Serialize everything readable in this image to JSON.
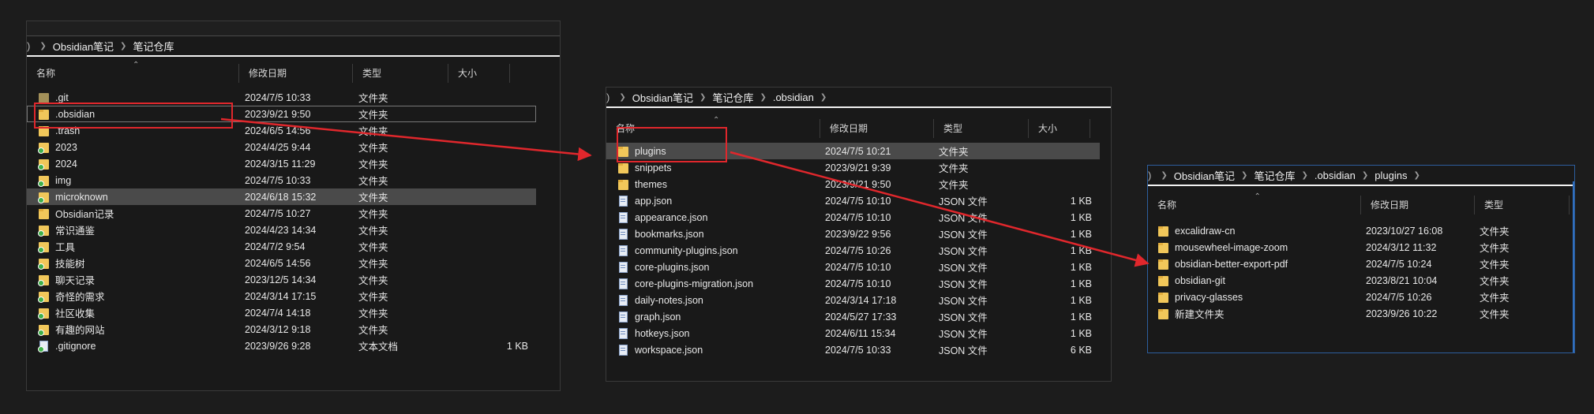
{
  "colors": {
    "background": "#1c1c1c",
    "window": "#191919",
    "selected_row": "#4a4a4a",
    "highlight_box": "#e0272c",
    "folder": "#f1c75a",
    "sync_badge": "#3fb04a"
  },
  "headers": {
    "name": "名称",
    "modified": "修改日期",
    "type": "类型",
    "size": "大小"
  },
  "win1": {
    "breadcrumb": [
      "Obsidian笔记",
      "笔记仓库"
    ],
    "rows": [
      {
        "name": ".git",
        "modified": "2024/7/5 10:33",
        "type": "文件夹",
        "size": "",
        "icon": "folder-dim-icon"
      },
      {
        "name": ".obsidian",
        "modified": "2023/9/21 9:50",
        "type": "文件夹",
        "size": "",
        "icon": "folder-icon"
      },
      {
        "name": ".trash",
        "modified": "2024/6/5 14:56",
        "type": "文件夹",
        "size": "",
        "icon": "folder-icon"
      },
      {
        "name": "2023",
        "modified": "2024/4/25 9:44",
        "type": "文件夹",
        "size": "",
        "icon": "folder-sync-icon"
      },
      {
        "name": "2024",
        "modified": "2024/3/15 11:29",
        "type": "文件夹",
        "size": "",
        "icon": "folder-sync-icon"
      },
      {
        "name": "img",
        "modified": "2024/7/5 10:33",
        "type": "文件夹",
        "size": "",
        "icon": "folder-sync-icon"
      },
      {
        "name": "microknown",
        "modified": "2024/6/18 15:32",
        "type": "文件夹",
        "size": "",
        "icon": "folder-sync-icon"
      },
      {
        "name": "Obsidian记录",
        "modified": "2024/7/5 10:27",
        "type": "文件夹",
        "size": "",
        "icon": "folder-icon"
      },
      {
        "name": "常识通鉴",
        "modified": "2024/4/23 14:34",
        "type": "文件夹",
        "size": "",
        "icon": "folder-sync-icon"
      },
      {
        "name": "工具",
        "modified": "2024/7/2 9:54",
        "type": "文件夹",
        "size": "",
        "icon": "folder-sync-icon"
      },
      {
        "name": "技能树",
        "modified": "2024/6/5 14:56",
        "type": "文件夹",
        "size": "",
        "icon": "folder-sync-icon"
      },
      {
        "name": "聊天记录",
        "modified": "2023/12/5 14:34",
        "type": "文件夹",
        "size": "",
        "icon": "folder-sync-icon"
      },
      {
        "name": "奇怪的需求",
        "modified": "2024/3/14 17:15",
        "type": "文件夹",
        "size": "",
        "icon": "folder-sync-icon"
      },
      {
        "name": "社区收集",
        "modified": "2024/7/4 14:18",
        "type": "文件夹",
        "size": "",
        "icon": "folder-sync-icon"
      },
      {
        "name": "有趣的网站",
        "modified": "2024/3/12 9:18",
        "type": "文件夹",
        "size": "",
        "icon": "folder-sync-icon"
      },
      {
        "name": ".gitignore",
        "modified": "2023/9/26 9:28",
        "type": "文本文档",
        "size": "1 KB",
        "icon": "file-sync-icon"
      }
    ]
  },
  "win2": {
    "breadcrumb": [
      "Obsidian笔记",
      "笔记仓库",
      ".obsidian"
    ],
    "rows": [
      {
        "name": "plugins",
        "modified": "2024/7/5 10:21",
        "type": "文件夹",
        "size": "",
        "icon": "folder-icon"
      },
      {
        "name": "snippets",
        "modified": "2023/9/21 9:39",
        "type": "文件夹",
        "size": "",
        "icon": "folder-icon"
      },
      {
        "name": "themes",
        "modified": "2023/9/21 9:50",
        "type": "文件夹",
        "size": "",
        "icon": "folder-icon"
      },
      {
        "name": "app.json",
        "modified": "2024/7/5 10:10",
        "type": "JSON 文件",
        "size": "1 KB",
        "icon": "file-icon"
      },
      {
        "name": "appearance.json",
        "modified": "2024/7/5 10:10",
        "type": "JSON 文件",
        "size": "1 KB",
        "icon": "file-icon"
      },
      {
        "name": "bookmarks.json",
        "modified": "2023/9/22 9:56",
        "type": "JSON 文件",
        "size": "1 KB",
        "icon": "file-icon"
      },
      {
        "name": "community-plugins.json",
        "modified": "2024/7/5 10:26",
        "type": "JSON 文件",
        "size": "1 KB",
        "icon": "file-icon"
      },
      {
        "name": "core-plugins.json",
        "modified": "2024/7/5 10:10",
        "type": "JSON 文件",
        "size": "1 KB",
        "icon": "file-icon"
      },
      {
        "name": "core-plugins-migration.json",
        "modified": "2024/7/5 10:10",
        "type": "JSON 文件",
        "size": "1 KB",
        "icon": "file-icon"
      },
      {
        "name": "daily-notes.json",
        "modified": "2024/3/14 17:18",
        "type": "JSON 文件",
        "size": "1 KB",
        "icon": "file-icon"
      },
      {
        "name": "graph.json",
        "modified": "2024/5/27 17:33",
        "type": "JSON 文件",
        "size": "1 KB",
        "icon": "file-icon"
      },
      {
        "name": "hotkeys.json",
        "modified": "2024/6/11 15:34",
        "type": "JSON 文件",
        "size": "1 KB",
        "icon": "file-icon"
      },
      {
        "name": "workspace.json",
        "modified": "2024/7/5 10:33",
        "type": "JSON 文件",
        "size": "6 KB",
        "icon": "file-icon"
      }
    ]
  },
  "win3": {
    "breadcrumb": [
      "Obsidian笔记",
      "笔记仓库",
      ".obsidian",
      "plugins"
    ],
    "rows": [
      {
        "name": "excalidraw-cn",
        "modified": "2023/10/27 16:08",
        "type": "文件夹",
        "icon": "folder-icon"
      },
      {
        "name": "mousewheel-image-zoom",
        "modified": "2024/3/12 11:32",
        "type": "文件夹",
        "icon": "folder-icon"
      },
      {
        "name": "obsidian-better-export-pdf",
        "modified": "2024/7/5 10:24",
        "type": "文件夹",
        "icon": "folder-icon"
      },
      {
        "name": "obsidian-git",
        "modified": "2023/8/21 10:04",
        "type": "文件夹",
        "icon": "folder-icon"
      },
      {
        "name": "privacy-glasses",
        "modified": "2024/7/5 10:26",
        "type": "文件夹",
        "icon": "folder-icon"
      },
      {
        "name": "新建文件夹",
        "modified": "2023/9/26 10:22",
        "type": "文件夹",
        "icon": "folder-icon"
      }
    ]
  }
}
